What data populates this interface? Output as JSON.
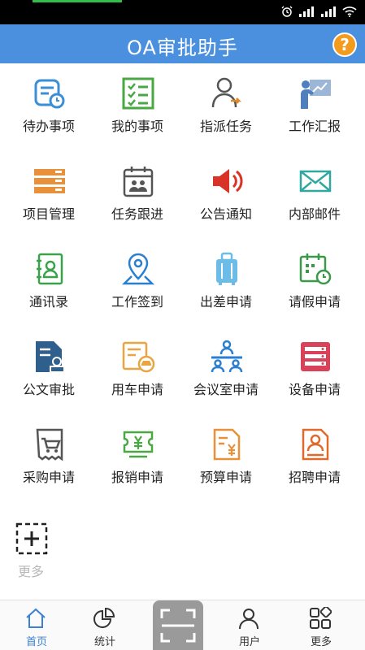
{
  "header": {
    "title": "OA审批助手",
    "help_label": "?"
  },
  "apps": [
    {
      "label": "待办事项",
      "icon": "todo-icon"
    },
    {
      "label": "我的事项",
      "icon": "checklist-icon"
    },
    {
      "label": "指派任务",
      "icon": "assign-person-icon"
    },
    {
      "label": "工作汇报",
      "icon": "presentation-icon"
    },
    {
      "label": "项目管理",
      "icon": "stack-icon"
    },
    {
      "label": "任务跟进",
      "icon": "calendar-people-icon"
    },
    {
      "label": "公告通知",
      "icon": "speaker-icon"
    },
    {
      "label": "内部邮件",
      "icon": "envelope-icon"
    },
    {
      "label": "通讯录",
      "icon": "contact-book-icon"
    },
    {
      "label": "工作签到",
      "icon": "location-pin-icon"
    },
    {
      "label": "出差申请",
      "icon": "luggage-icon"
    },
    {
      "label": "请假申请",
      "icon": "calendar-clock-icon"
    },
    {
      "label": "公文审批",
      "icon": "document-stamp-icon"
    },
    {
      "label": "用车申请",
      "icon": "car-document-icon"
    },
    {
      "label": "会议室申请",
      "icon": "meeting-room-icon"
    },
    {
      "label": "设备申请",
      "icon": "server-rack-icon"
    },
    {
      "label": "采购申请",
      "icon": "shopping-cart-receipt-icon"
    },
    {
      "label": "报销申请",
      "icon": "yen-ticket-icon"
    },
    {
      "label": "预算申请",
      "icon": "yen-document-icon"
    },
    {
      "label": "招聘申请",
      "icon": "resume-icon"
    },
    {
      "label": "更多",
      "icon": "add-dashed-icon"
    }
  ],
  "tabbar": {
    "home": "首页",
    "stats": "统计",
    "user": "用户",
    "more": "更多"
  },
  "colors": {
    "header": "#4a90df",
    "accent_blue": "#3a7fd8",
    "help_orange": "#f39b1d"
  }
}
